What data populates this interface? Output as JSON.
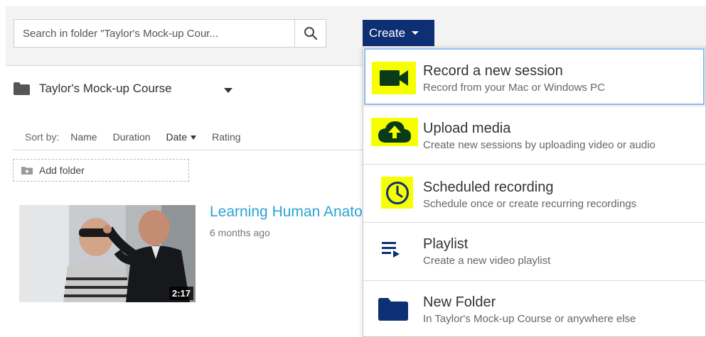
{
  "search": {
    "placeholder": "Search in folder \"Taylor's Mock-up Cour..."
  },
  "create": {
    "label": "Create"
  },
  "folder": {
    "name": "Taylor's Mock-up Course"
  },
  "sort": {
    "label": "Sort by:",
    "options": [
      "Name",
      "Duration",
      "Date",
      "Rating"
    ],
    "active": "Date"
  },
  "add_folder": {
    "label": "Add folder"
  },
  "session": {
    "title": "Learning Human Anatomy",
    "age": "6 months ago",
    "duration": "2:17"
  },
  "menu": {
    "items": [
      {
        "title": "Record a new session",
        "subtitle": "Record from your Mac or Windows PC",
        "icon": "video-camera-icon",
        "highlighted": true
      },
      {
        "title": "Upload media",
        "subtitle": "Create new sessions by uploading video or audio",
        "icon": "cloud-upload-icon",
        "highlighted": true
      },
      {
        "title": "Scheduled recording",
        "subtitle": "Schedule once or create recurring recordings",
        "icon": "clock-icon",
        "highlighted": true
      },
      {
        "title": "Playlist",
        "subtitle": "Create a new video playlist",
        "icon": "playlist-icon",
        "highlighted": false
      },
      {
        "title": "New Folder",
        "subtitle": "In Taylor's Mock-up Course or anywhere else",
        "icon": "folder-icon",
        "highlighted": false
      }
    ]
  },
  "colors": {
    "brand": "#0e2f74",
    "highlight": "#f5ff00",
    "link": "#2aa4d5",
    "icon_dark": "#0a3b18"
  }
}
